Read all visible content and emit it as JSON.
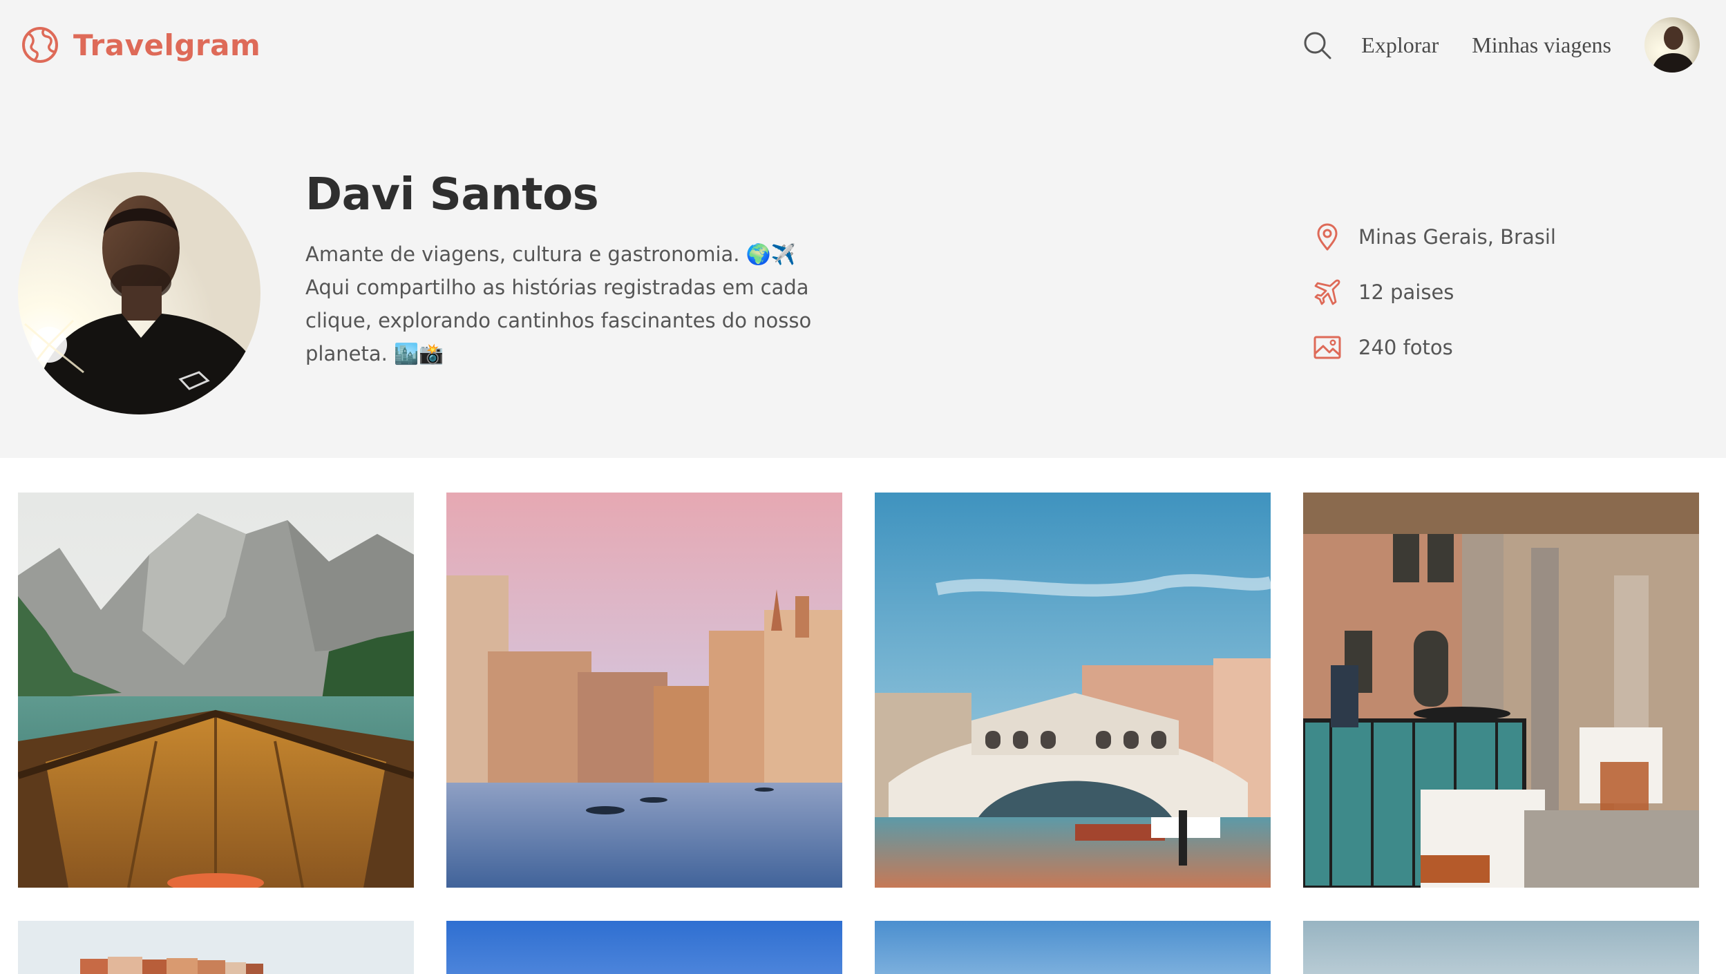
{
  "app": {
    "name": "Travelgram",
    "brand_color": "#de6a58"
  },
  "nav": {
    "search_icon": "search-icon",
    "links": [
      "Explorar",
      "Minhas viagens"
    ],
    "avatar": "user-avatar"
  },
  "profile": {
    "name": "Davi Santos",
    "bio_lines": [
      "Amante de viagens, cultura e gastronomia. 🌍✈️",
      "Aqui compartilho as histórias registradas em cada",
      "clique, explorando cantinhos fascinantes do nosso",
      "planeta. 🏙️📸"
    ],
    "stats": [
      {
        "icon": "location-pin-icon",
        "text": "Minas Gerais, Brasil"
      },
      {
        "icon": "airplane-icon",
        "text": "12 paises"
      },
      {
        "icon": "image-icon",
        "text": "240 fotos"
      }
    ]
  },
  "gallery": {
    "photos": [
      {
        "subject": "mountain lake with boat"
      },
      {
        "subject": "venice canal at sunset"
      },
      {
        "subject": "rialto bridge"
      },
      {
        "subject": "venice canal-side restaurant"
      },
      {
        "subject": "coastal village"
      },
      {
        "subject": "blue sky"
      },
      {
        "subject": "sky"
      },
      {
        "subject": "hazy sky"
      }
    ]
  }
}
